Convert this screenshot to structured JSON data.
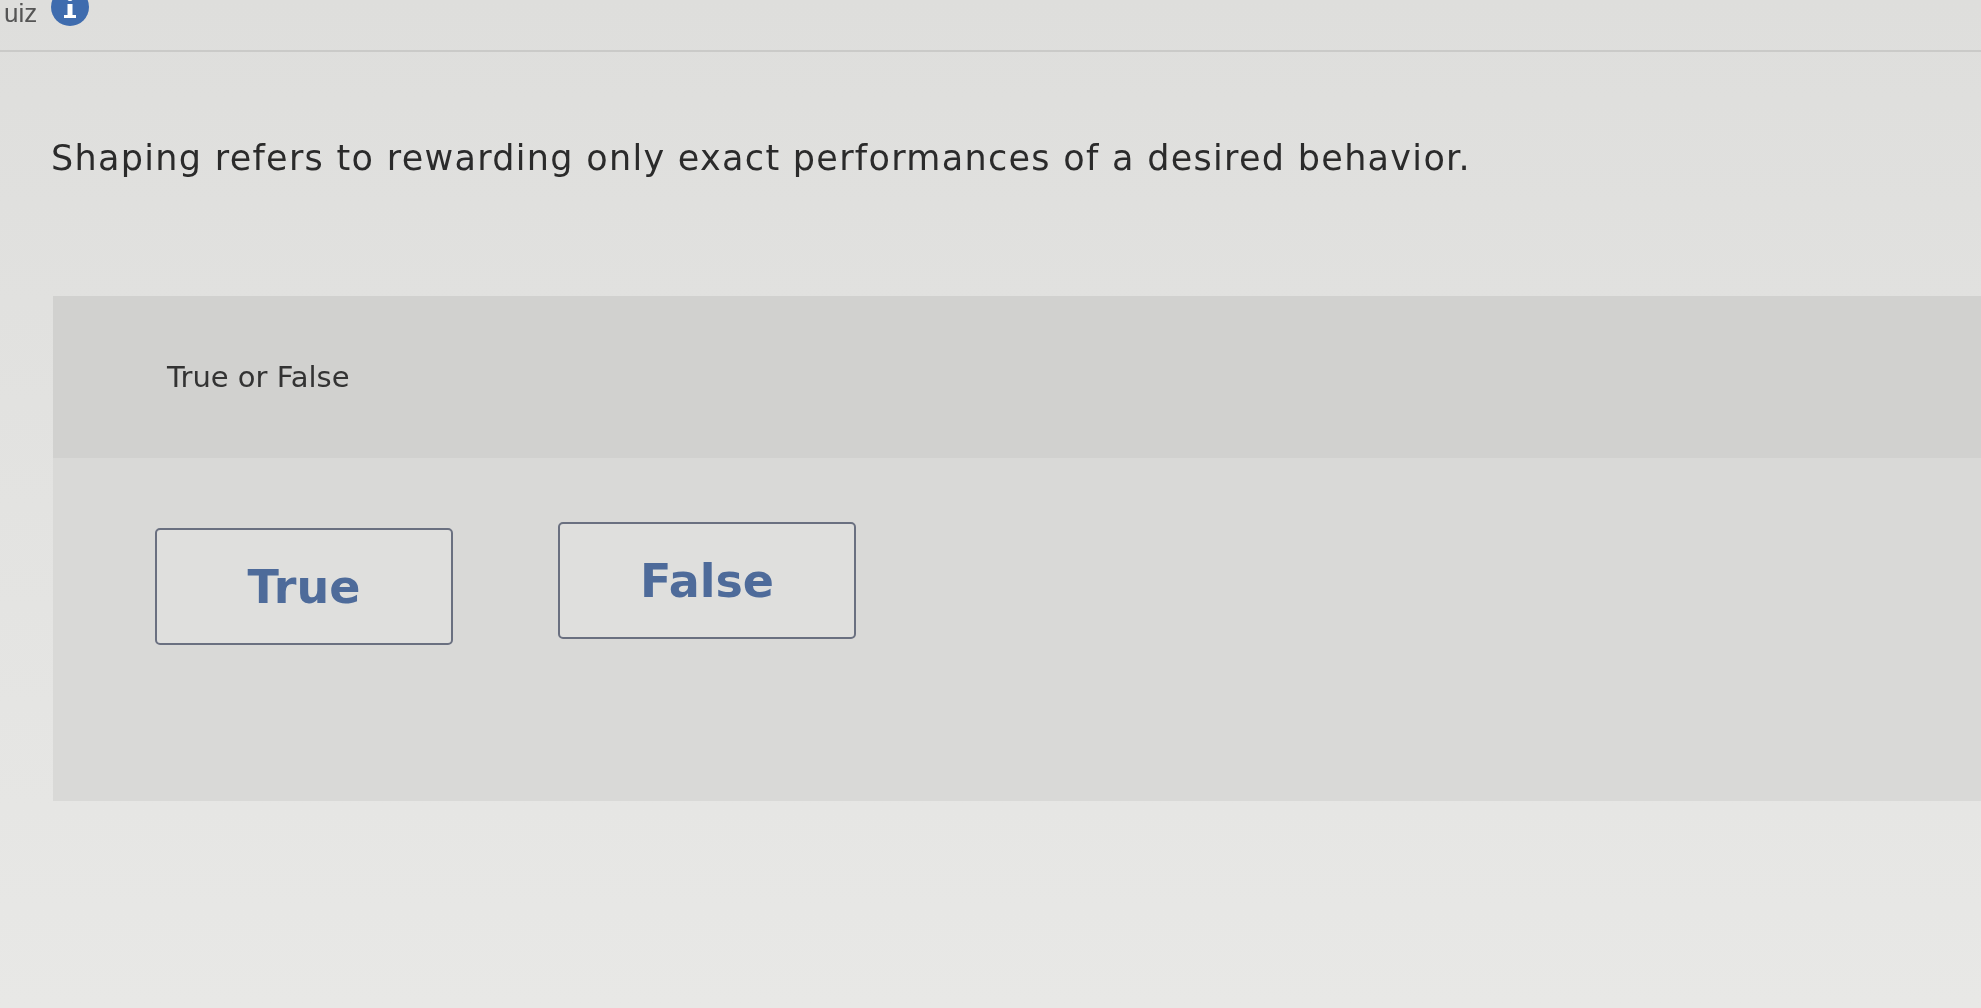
{
  "header": {
    "title": "uiz"
  },
  "question": {
    "prompt": "Shaping refers to rewarding only exact performances of a desired behavior."
  },
  "answer_panel": {
    "instruction": "True or False",
    "options": [
      {
        "label": "True",
        "selected": false
      },
      {
        "label": "False",
        "selected": false
      }
    ]
  }
}
